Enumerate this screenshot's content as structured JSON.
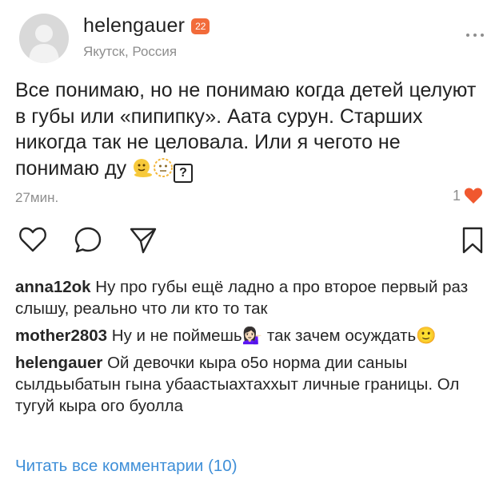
{
  "post": {
    "username": "helengauer",
    "badge": "22",
    "location": "Якутск, Россия",
    "text": "Все понимаю, но не понимаю когда детей целуют в губы или «пипипку». Аата сурун. Старших никогда так не целовала. Или я чегото не понимаю ду",
    "text_emojis": [
      "🫠",
      "🫥",
      "?"
    ],
    "time": "27мин.",
    "likes": "1"
  },
  "comments": [
    {
      "user": "anna12ok",
      "text": "Ну про губы ещё ладно а про второе первый раз слышу, реально что ли кто то так"
    },
    {
      "user": "mother2803",
      "text": "Ну и не поймешь💁🏻‍♀️ так зачем осуждать🙂"
    },
    {
      "user": "helengauer",
      "text": "Ой девочки кыра о5о норма дии саныы сылдьыбатын гына убаастыахтаххыт личные границы. Ол тугуй кыра ого буолла"
    }
  ],
  "view_all": "Читать все комментарии (10)",
  "colors": {
    "badge": "#f26b3a",
    "like": "#f0582f",
    "link": "#3f8fd8",
    "secondary": "#8e8e8e"
  },
  "icons": [
    "more-icon",
    "heart-icon",
    "comment-icon",
    "send-icon",
    "bookmark-icon",
    "liked-heart-icon"
  ]
}
